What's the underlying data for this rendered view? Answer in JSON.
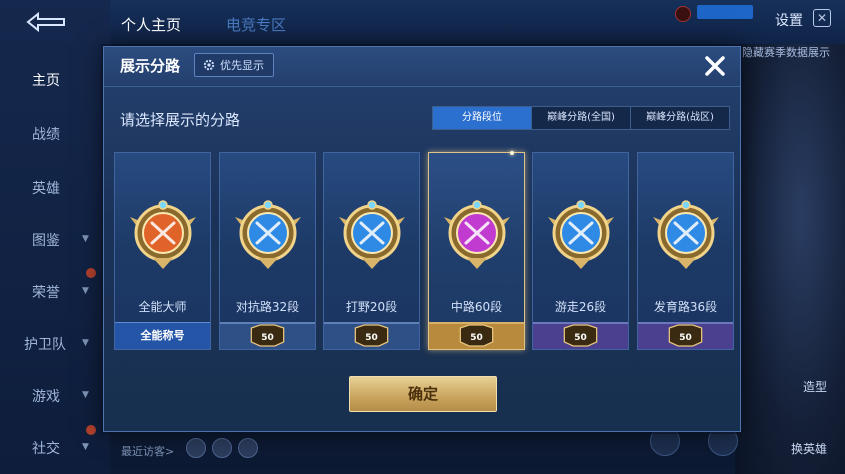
{
  "background": {
    "top_tabs": [
      "个人主页",
      "电竞专区"
    ],
    "settings_label": "设置",
    "right_text": "隐藏赛季数据展示",
    "sidebar": [
      {
        "label": "主页",
        "has_chevron": false
      },
      {
        "label": "战绩",
        "has_chevron": false
      },
      {
        "label": "英雄",
        "has_chevron": false
      },
      {
        "label": "图鉴",
        "has_chevron": true
      },
      {
        "label": "荣誉",
        "has_chevron": true
      },
      {
        "label": "护卫队",
        "has_chevron": true
      },
      {
        "label": "游戏",
        "has_chevron": true
      },
      {
        "label": "社交",
        "has_chevron": true
      }
    ],
    "recent_visits_label": "最近访客>",
    "right_lower_labels": [
      "造型",
      "换英雄"
    ]
  },
  "modal": {
    "title": "展示分路",
    "priority_button": "优先显示",
    "subtitle": "请选择展示的分路",
    "segment_tabs": [
      {
        "label": "分路段位",
        "active": true
      },
      {
        "label": "巅峰分路(全国)",
        "active": false
      },
      {
        "label": "巅峰分路(战区)",
        "active": false
      }
    ],
    "cards": [
      {
        "label": "全能大师",
        "footer": "全能称号",
        "rank": "",
        "emblem_color": "#e0642a",
        "selected": false,
        "footer_type": "title"
      },
      {
        "label": "对抗路32段",
        "footer": "",
        "rank": "50",
        "emblem_color": "#2f8ae6",
        "selected": false,
        "footer_type": "rank"
      },
      {
        "label": "打野20段",
        "footer": "",
        "rank": "50",
        "emblem_color": "#2f8ae6",
        "selected": false,
        "footer_type": "rank"
      },
      {
        "label": "中路60段",
        "footer": "",
        "rank": "50",
        "emblem_color": "#c23bd0",
        "selected": true,
        "footer_type": "rank"
      },
      {
        "label": "游走26段",
        "footer": "",
        "rank": "50",
        "emblem_color": "#2f8ae6",
        "selected": false,
        "footer_type": "rank"
      },
      {
        "label": "发育路36段",
        "footer": "",
        "rank": "50",
        "emblem_color": "#2f8ae6",
        "selected": false,
        "footer_type": "rank"
      }
    ],
    "confirm_label": "确定"
  }
}
